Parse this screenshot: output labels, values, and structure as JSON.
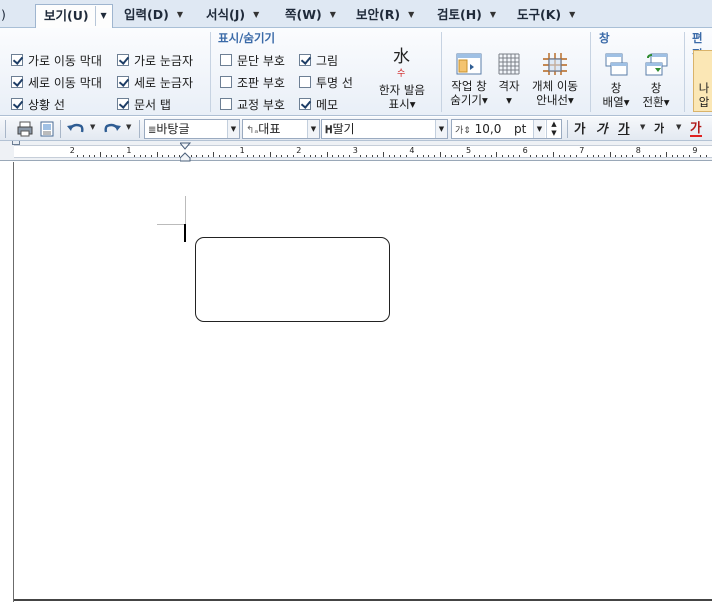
{
  "menu": {
    "tabs": [
      {
        "label": "보기(U)",
        "active": true
      },
      {
        "label": "입력(D)"
      },
      {
        "label": "서식(J)"
      },
      {
        "label": "쪽(W)"
      },
      {
        "label": "보안(R)"
      },
      {
        "label": "검토(H)"
      },
      {
        "label": "도구(K)"
      }
    ],
    "left_fragment": ")"
  },
  "ribbon": {
    "view_checks": [
      {
        "label": "가로 이동 막대",
        "checked": true
      },
      {
        "label": "세로 이동 막대",
        "checked": true
      },
      {
        "label": "상황 선",
        "checked": true
      },
      {
        "label": "가로 눈금자",
        "checked": true
      },
      {
        "label": "세로 눈금자",
        "checked": true
      },
      {
        "label": "문서 탭",
        "checked": true
      }
    ],
    "show_hide": {
      "title": "표시/숨기기",
      "checks": [
        {
          "label": "문단 부호",
          "checked": false
        },
        {
          "label": "조판 부호",
          "checked": false
        },
        {
          "label": "교정 부호",
          "checked": false
        },
        {
          "label": "그림",
          "checked": true
        },
        {
          "label": "투명 선",
          "checked": false
        },
        {
          "label": "메모",
          "checked": true
        }
      ]
    },
    "hanja": {
      "line1": "한자 발음",
      "line2": "표시▾",
      "glyph": "水",
      "sub": "수"
    },
    "task_pane": {
      "line1": "작업 창",
      "line2": "숨기기▾"
    },
    "grid": {
      "line1": "격자",
      "line2": "▾"
    },
    "object_guide": {
      "line1": "개체 이동",
      "line2": "안내선▾"
    },
    "window_group": {
      "title": "창",
      "arrange": {
        "line1": "창",
        "line2": "배열▾"
      },
      "switch": {
        "line1": "창",
        "line2": "전환▾"
      }
    },
    "edit_group": {
      "title": "편집",
      "btn_line1": "나",
      "btn_line2": "압"
    }
  },
  "toolbar": {
    "style": "바탕글",
    "lang": "대표",
    "font": "딸기",
    "size": "10,0",
    "unit": "pt",
    "fmt": [
      "가",
      "가",
      "가",
      "가",
      "가"
    ]
  },
  "ruler": {
    "numbers": [
      "2",
      "1",
      "1",
      "2",
      "3",
      "4",
      "5",
      "6",
      "7",
      "8",
      "9"
    ]
  },
  "colors": {
    "accent": "#3a6aa8",
    "tab_bar": "#dfe8f3",
    "ribbon_bottom": "#e9eff7"
  }
}
